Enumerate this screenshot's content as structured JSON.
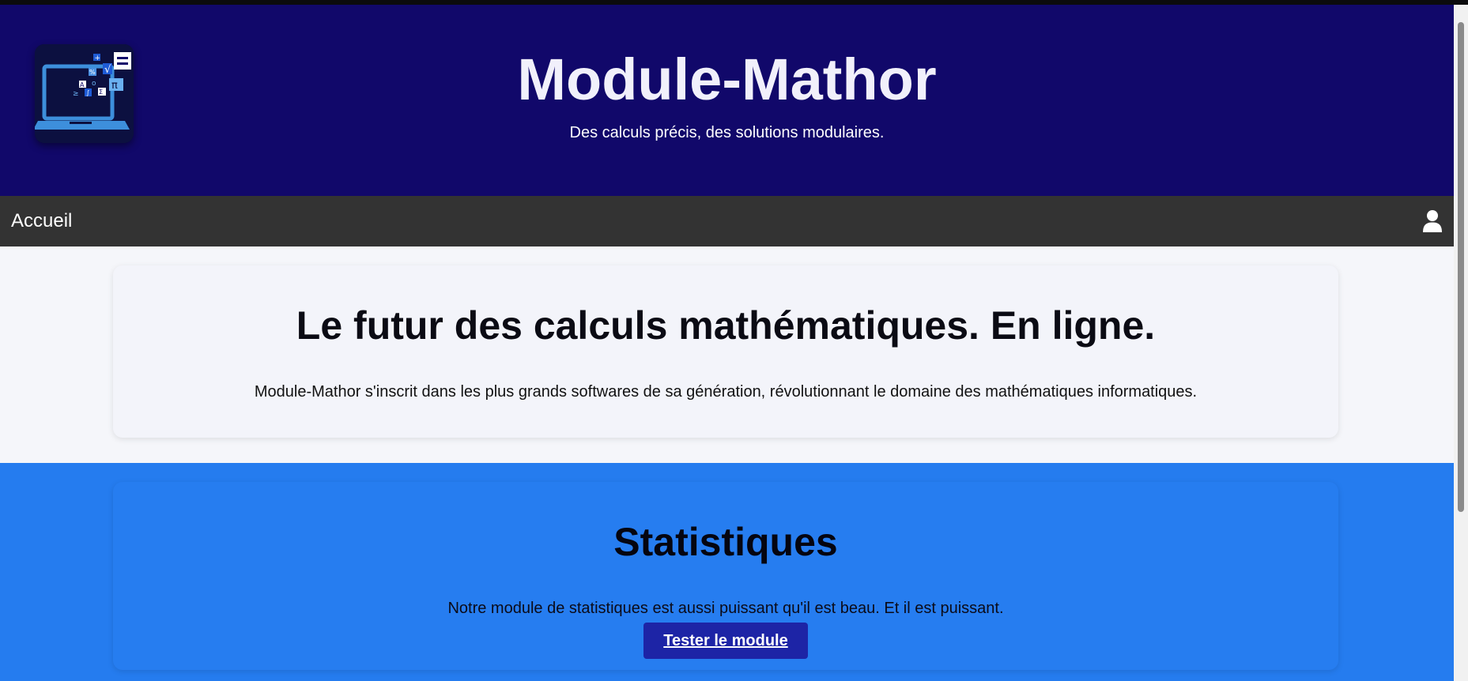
{
  "header": {
    "title": "Module-Mathor",
    "tagline": "Des calculs précis, des solutions modulaires.",
    "logo": {
      "icon": "laptop-math-logo",
      "symbols": [
        "=",
        "+",
        "%",
        "√",
        "π",
        "o",
        "Σ",
        "≥",
        "∫",
        "A"
      ]
    }
  },
  "nav": {
    "home_label": "Accueil",
    "user_icon": "user-icon"
  },
  "intro": {
    "heading": "Le futur des calculs mathématiques. En ligne.",
    "text": "Module-Mathor s'inscrit dans les plus grands softwares de sa génération, révolutionnant le domaine des mathématiques informatiques."
  },
  "stats": {
    "heading": "Statistiques",
    "text": "Notre module de statistiques est aussi puissant qu'il est beau. Et il est puissant.",
    "button_label": "Tester le module"
  },
  "colors": {
    "header_bg": "#11086a",
    "nav_bg": "#333333",
    "stats_bg": "#257cef",
    "button_bg": "#1d24a6"
  }
}
